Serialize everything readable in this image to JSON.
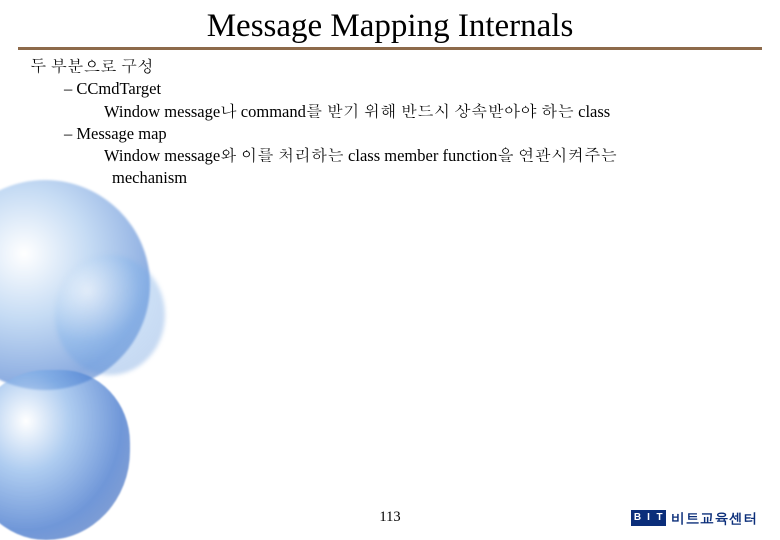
{
  "title": "Message Mapping Internals",
  "outline": {
    "lvl1": "두 부분으로 구성",
    "item1": {
      "bullet": "– CCmdTarget",
      "desc": "Window message나 command를 받기 위해 반드시 상속받아야 하는 class"
    },
    "item2": {
      "bullet": "– Message map",
      "desc_line1": "Window message와 이를 처리하는 class member function을 연관시켜주는",
      "desc_line2": "mechanism"
    }
  },
  "page_number": "113",
  "footer": {
    "logo_b": "B",
    "logo_i": "I",
    "logo_t": "T",
    "brand": "비트교육센터"
  }
}
